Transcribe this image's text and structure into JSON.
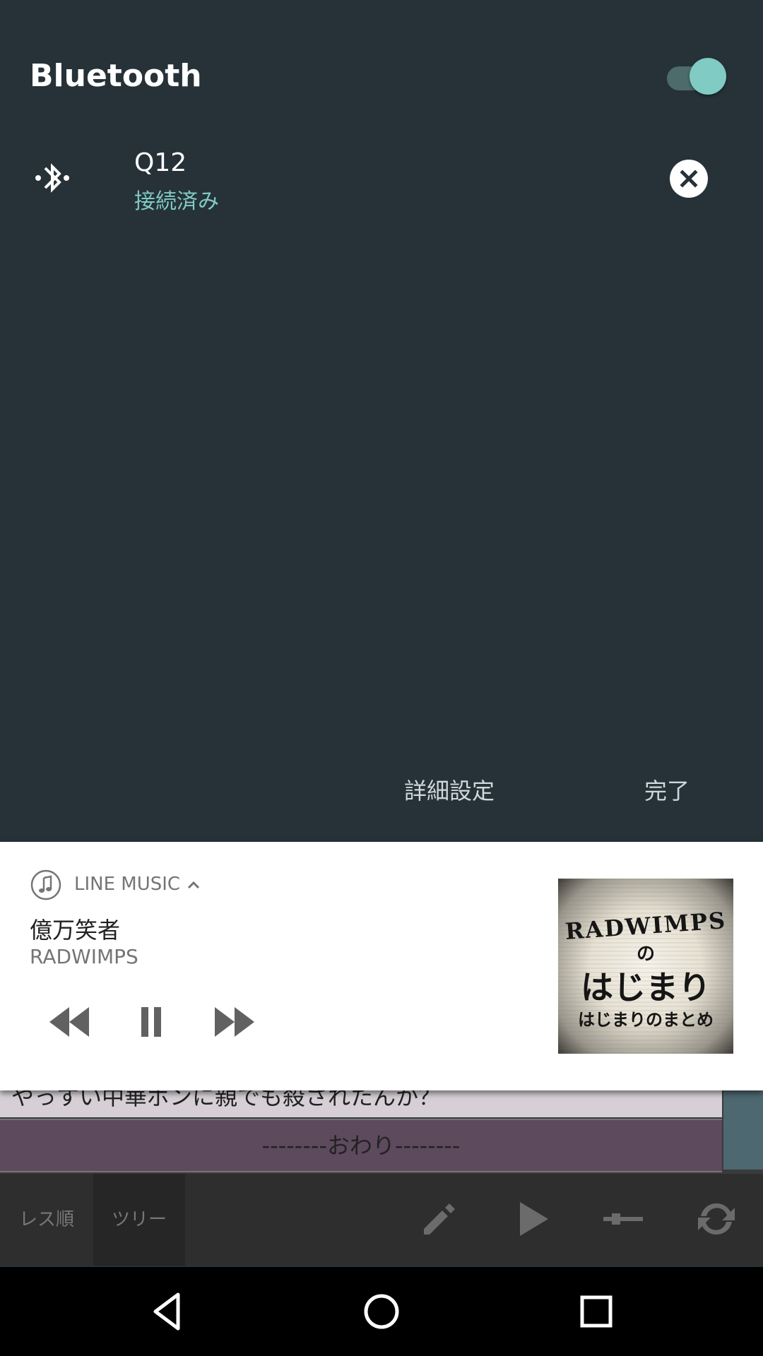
{
  "bluetooth_panel": {
    "title": "Bluetooth",
    "toggle_on": true,
    "device": {
      "name": "Q12",
      "status": "接続済み"
    },
    "buttons": {
      "settings_label": "詳細設定",
      "done_label": "完了"
    }
  },
  "media_notification": {
    "app_name": "LINE MUSIC",
    "track_title": "億万笑者",
    "artist": "RADWIMPS",
    "controls": [
      "rewind",
      "pause",
      "fast-forward"
    ],
    "album_art": {
      "line1": "RADWIMPS",
      "line2": "の",
      "line3": "はじまり",
      "line4": "はじまりのまとめ"
    }
  },
  "background_app": {
    "row1_text": "やっすい中華ボンに親でも殺されたんか？",
    "row2_text": "--------おわり--------",
    "toolbar_tabs": [
      "レス順",
      "ツリー"
    ],
    "toolbar_icons": [
      "pencil-icon",
      "play-icon",
      "slider-icon",
      "refresh-icon"
    ]
  },
  "colors": {
    "panel_bg": "#263238",
    "accent": "#80cbc4",
    "card_bg": "#ffffff"
  }
}
